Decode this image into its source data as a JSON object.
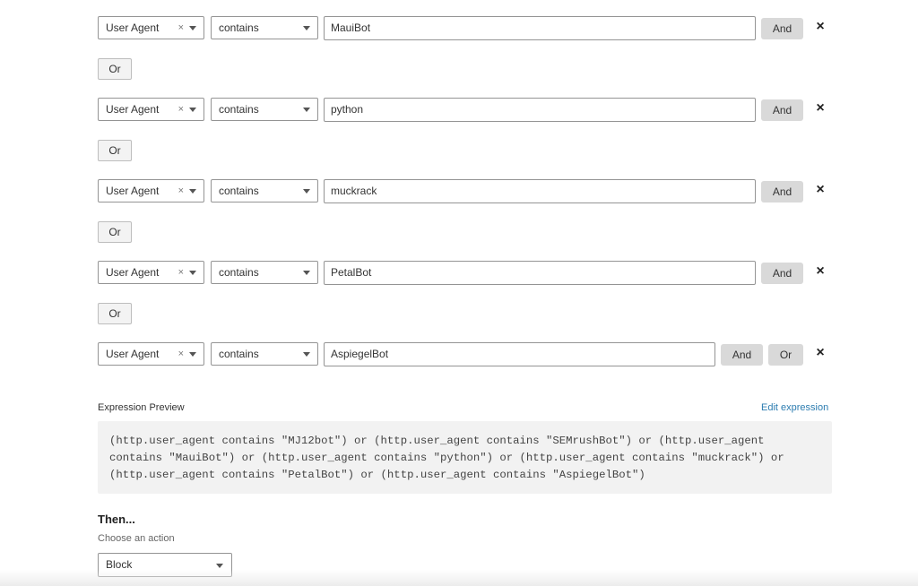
{
  "rows": [
    {
      "field": "User Agent",
      "clear": "×",
      "operator": "contains",
      "value": "MauiBot",
      "and_label": "And"
    },
    {
      "field": "User Agent",
      "clear": "×",
      "operator": "contains",
      "value": "python",
      "and_label": "And"
    },
    {
      "field": "User Agent",
      "clear": "×",
      "operator": "contains",
      "value": "muckrack",
      "and_label": "And"
    },
    {
      "field": "User Agent",
      "clear": "×",
      "operator": "contains",
      "value": "PetalBot",
      "and_label": "And"
    },
    {
      "field": "User Agent",
      "clear": "×",
      "operator": "contains",
      "value": "AspiegelBot",
      "and_label": "And",
      "or_label": "Or"
    }
  ],
  "or_separator": "Or",
  "remove_icon": "×",
  "expression_preview": {
    "label": "Expression Preview",
    "edit_link": "Edit expression",
    "lines": [
      "(http.user_agent contains \"MJ12bot\") or (http.user_agent contains \"SEMrushBot\") or (http.user_agent",
      "contains \"MauiBot\") or (http.user_agent contains \"python\") or (http.user_agent contains \"muckrack\") or",
      "(http.user_agent contains \"PetalBot\") or (http.user_agent contains \"AspiegelBot\")"
    ]
  },
  "then": {
    "heading": "Then...",
    "subheading": "Choose an action",
    "action": "Block"
  }
}
